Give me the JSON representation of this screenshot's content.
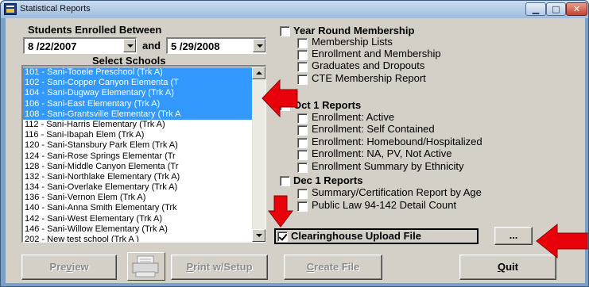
{
  "window": {
    "title": "Statistical Reports"
  },
  "students": {
    "heading": "Students Enrolled Between",
    "start_date": "8 /22/2007",
    "and_label": "and",
    "end_date": "5 /29/2008"
  },
  "schools": {
    "heading": "Select Schools",
    "items": [
      {
        "label": "101 - Sani-Tooele Preschool (Trk A)",
        "selected": true
      },
      {
        "label": "102 - Sani-Copper Canyon Elementa (T",
        "selected": true
      },
      {
        "label": "104 - Sani-Dugway Elementary (Trk A)",
        "selected": true
      },
      {
        "label": "106 - Sani-East Elementary (Trk A)",
        "selected": true
      },
      {
        "label": "108 - Sani-Grantsville Elementary (Trk A",
        "selected": true
      },
      {
        "label": "112 - Sani-Harris Elementary (Trk A)",
        "selected": false
      },
      {
        "label": "116 - Sani-Ibapah Elem (Trk A)",
        "selected": false
      },
      {
        "label": "120 - Sani-Stansbury Park Elem (Trk A)",
        "selected": false
      },
      {
        "label": "124 - Sani-Rose Springs Elementar (Tr",
        "selected": false
      },
      {
        "label": "128 - Sani-Middle Canyon Elementa (Tr",
        "selected": false
      },
      {
        "label": "132 - Sani-Northlake Elementary (Trk A)",
        "selected": false
      },
      {
        "label": "134 - Sani-Overlake Elementary (Trk A)",
        "selected": false
      },
      {
        "label": "136 - Sani-Vernon Elem (Trk A)",
        "selected": false
      },
      {
        "label": "140 - Sani-Anna Smith Elementary (Trk",
        "selected": false
      },
      {
        "label": "142 - Sani-West Elementary (Trk A)",
        "selected": false
      },
      {
        "label": "146 - Sani-Willow Elementary (Trk A)",
        "selected": false
      },
      {
        "label": "202 - New test school (Trk A )",
        "selected": false
      }
    ]
  },
  "reports": {
    "year_round": "Year Round Membership",
    "membership_lists": "Membership Lists",
    "enrollment_membership": "Enrollment and Membership",
    "graduates_dropouts": "Graduates and Dropouts",
    "cte_membership": "CTE Membership Report",
    "oct1": "Oct 1 Reports",
    "enroll_active": "Enrollment: Active",
    "enroll_self": "Enrollment: Self Contained",
    "enroll_homebound": "Enrollment: Homebound/Hospitalized",
    "enroll_na": "Enrollment: NA, PV, Not Active",
    "enroll_summary": "Enrollment Summary by Ethnicity",
    "dec1": "Dec 1 Reports",
    "summary_cert": "Summary/Certification Report by Age",
    "public_law": "Public Law 94-142 Detail Count",
    "clearinghouse": "Clearinghouse Upload File",
    "clearinghouse_checked": true
  },
  "buttons": {
    "ellipsis": "...",
    "preview": "Preview",
    "print_setup": "Print w/Setup",
    "create_file": "Create File",
    "quit": "Quit"
  },
  "colors": {
    "annotation_arrow": "#e8000b",
    "selection": "#3399ff"
  }
}
